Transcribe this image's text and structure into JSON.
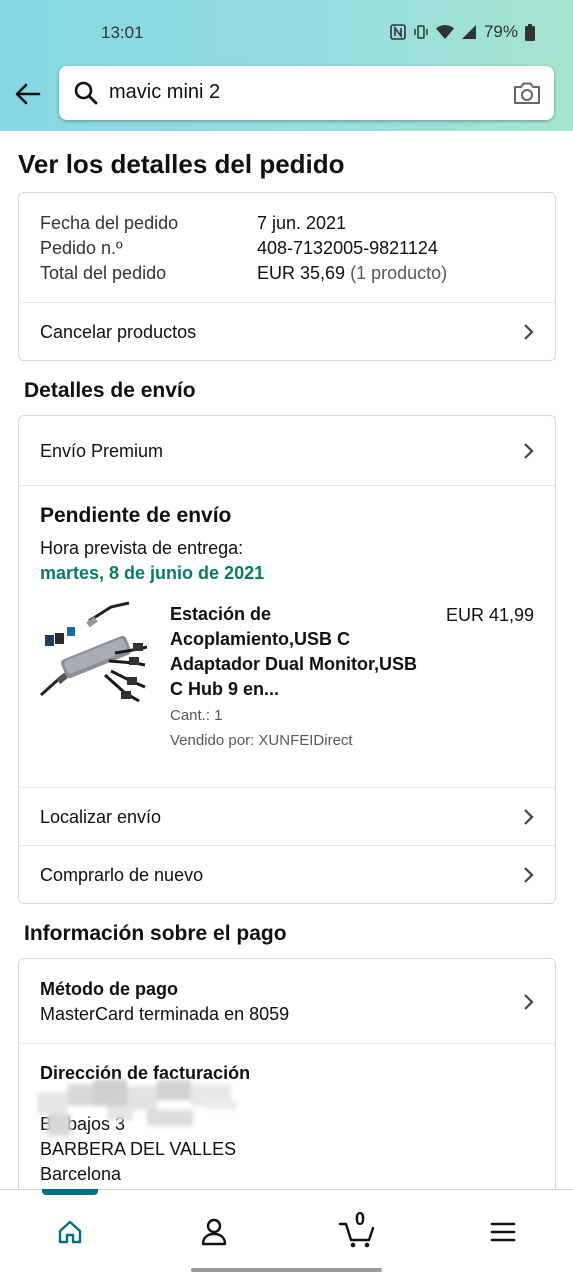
{
  "status_bar": {
    "time": "13:01",
    "battery": "79%",
    "icons": [
      "nfc-icon",
      "vibrate-icon",
      "wifi-icon",
      "signal-icon",
      "battery-icon"
    ]
  },
  "search": {
    "query": "mavic mini 2",
    "icons": [
      "back-arrow-icon",
      "search-icon",
      "camera-icon"
    ]
  },
  "page_title": "Ver los detalles del pedido",
  "order_summary": {
    "date_label": "Fecha del pedido",
    "date_value": "7 jun. 2021",
    "number_label": "Pedido n.º",
    "number_value": "408-7132005-9821124",
    "total_label": "Total del pedido",
    "total_value": "EUR 35,69",
    "total_count": "(1 producto)",
    "cancel_label": "Cancelar productos"
  },
  "shipping": {
    "section_title": "Detalles de envío",
    "shipping_speed": "Envío Premium",
    "status_title": "Pendiente de envío",
    "eta_label": "Hora prevista de entrega:",
    "eta_date": "martes, 8 de junio de 2021",
    "product": {
      "title": "Estación de Acoplamiento,USB C Adaptador Dual Monitor,USB C Hub 9 en...",
      "price": "EUR 41,99",
      "quantity": "Cant.: 1",
      "seller": "Vendido por: XUNFEIDirect"
    },
    "track_label": "Localizar envío",
    "buy_again_label": "Comprarlo de nuevo"
  },
  "payment": {
    "section_title": "Información sobre el pago",
    "method_title": "Método de pago",
    "method_value": "MasterCard terminada en 8059",
    "billing_title": "Dirección de facturación",
    "billing_line_2": "B       , bajos 3",
    "billing_city": "BARBERA DEL VALLES",
    "billing_province": "Barcelona"
  },
  "bottom_nav": {
    "items": [
      "home-icon",
      "account-icon",
      "cart-icon",
      "menu-icon"
    ],
    "cart_count": "0",
    "accent": "#007185"
  },
  "colors": {
    "accent_teal": "#007185",
    "delivery_green": "#067d62",
    "header_gradient_start": "#84d8e3",
    "header_gradient_end": "#a6e4cf"
  }
}
